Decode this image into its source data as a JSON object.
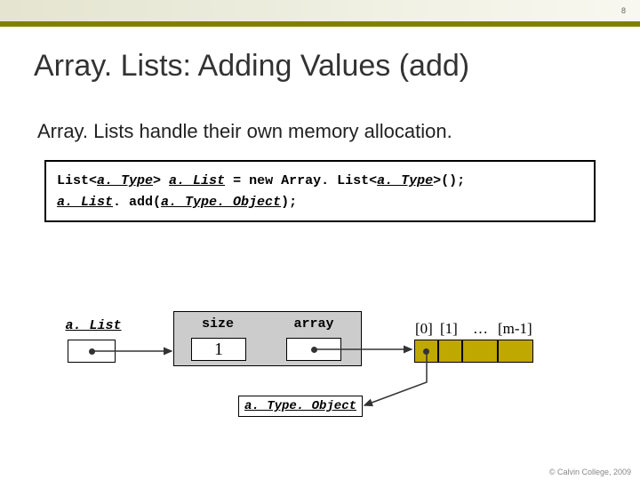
{
  "slide_number": "8",
  "title": "Array. Lists: Adding Values (add)",
  "subtitle": "Array. Lists handle their own memory allocation.",
  "code": {
    "line1_pre": "List<",
    "line1_type1": "a. Type",
    "line1_mid1": "> ",
    "line1_var": "a. List",
    "line1_mid2": " = new Array. List<",
    "line1_type2": "a. Type",
    "line1_end": ">();",
    "line2_var": "a. List",
    "line2_mid": ". add(",
    "line2_arg": "a. Type. Object",
    "line2_end": ");"
  },
  "diagram": {
    "alist_label": "a. List",
    "size_label": "size",
    "array_label": "array",
    "size_value": "1",
    "indices": {
      "i0": "[0]",
      "i1": "[1]",
      "dots": "…",
      "im": "[m-1]"
    },
    "object_label": "a. Type. Object"
  },
  "footer": "© Calvin College, 2009"
}
